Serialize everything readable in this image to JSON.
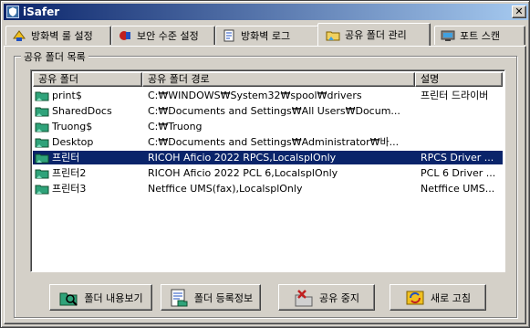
{
  "window": {
    "title": "iSafer",
    "close_glyph": "✕"
  },
  "tabs": [
    {
      "label": "방화벽 룰 설정",
      "icon": "firewall-rules-icon"
    },
    {
      "label": "보안 수준 설정",
      "icon": "security-level-icon"
    },
    {
      "label": "방화벽 로그",
      "icon": "firewall-log-icon"
    },
    {
      "label": "공유 폴더 관리",
      "icon": "shared-folder-icon",
      "active": true
    },
    {
      "label": "포트 스캔",
      "icon": "port-scan-icon"
    }
  ],
  "group": {
    "label": "공유 폴더 목록"
  },
  "list": {
    "columns": [
      "공유 폴더",
      "공유 폴더 경로",
      "설명"
    ],
    "rows": [
      {
        "name": "print$",
        "path": "C:₩WINDOWS₩System32₩spool₩drivers",
        "desc": "프린터 드라이버"
      },
      {
        "name": "SharedDocs",
        "path": "C:₩Documents and Settings₩All Users₩Docum...",
        "desc": ""
      },
      {
        "name": "Truong$",
        "path": "C:₩Truong",
        "desc": ""
      },
      {
        "name": "Desktop",
        "path": "C:₩Documents and Settings₩Administrator₩바...",
        "desc": ""
      },
      {
        "name": "프린터",
        "path": "RICOH Aficio 2022 RPCS,LocalsplOnly",
        "desc": "RPCS Driver ...",
        "selected": true
      },
      {
        "name": "프린터2",
        "path": "RICOH Aficio 2022 PCL 6,LocalsplOnly",
        "desc": "PCL 6 Driver ..."
      },
      {
        "name": "프린터3",
        "path": "Netffice UMS(fax),LocalsplOnly",
        "desc": "Netffice UMS..."
      }
    ]
  },
  "buttons": {
    "view": "폴더 내용보기",
    "info": "폴더 등록정보",
    "stop": "공유 중지",
    "refresh": "새로 고침"
  },
  "colors": {
    "selection": "#0a246a",
    "folder": "#2fa37a",
    "titlebar_start": "#0a246a",
    "titlebar_end": "#a6caf0"
  }
}
